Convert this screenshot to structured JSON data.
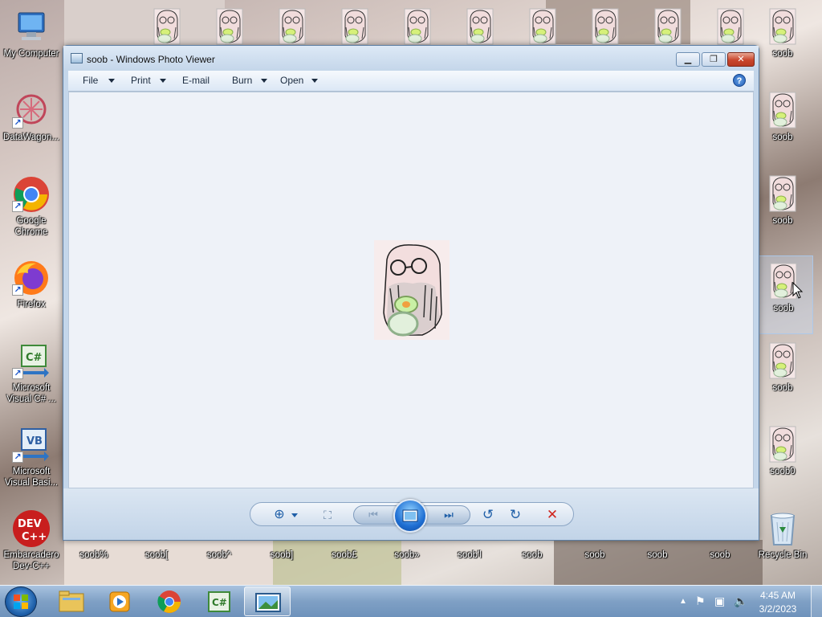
{
  "desktop": {
    "left_icons": [
      {
        "label": "My Computer",
        "icon": "computer-icon"
      },
      {
        "label": "DataWagon...",
        "icon": "datawagon-icon"
      },
      {
        "label": "Google Chrome",
        "icon": "chrome-icon"
      },
      {
        "label": "Firefox",
        "icon": "firefox-icon"
      },
      {
        "label": "Microsoft Visual C# ...",
        "icon": "visual-csharp-icon"
      },
      {
        "label": "Microsoft Visual Basi...",
        "icon": "visual-basic-icon"
      },
      {
        "label": "Embarcadero Dev-C++",
        "icon": "devcpp-icon"
      }
    ],
    "right_icons": [
      {
        "label": "soob",
        "icon": "soob-image-icon"
      },
      {
        "label": "soob",
        "icon": "soob-image-icon"
      },
      {
        "label": "soob",
        "icon": "soob-image-icon"
      },
      {
        "label": "soob",
        "icon": "soob-image-icon"
      },
      {
        "label": "soob",
        "icon": "soob-image-icon"
      },
      {
        "label": "soob0",
        "icon": "soob-image-icon"
      },
      {
        "label": "Recycle Bin",
        "icon": "recycle-bin-icon"
      }
    ],
    "bottom_icons": [
      "soob%",
      "soob[",
      "soob^",
      "soob]",
      "soob£",
      "soob»",
      "soob'l",
      "soob",
      "soob",
      "soob",
      "soob"
    ],
    "top_row_count": 11
  },
  "window": {
    "title": "soob - Windows Photo Viewer",
    "buttons": {
      "minimize": "minimize",
      "maximize": "maximize",
      "close": "close"
    },
    "menu": [
      {
        "label": "File",
        "dropdown": true
      },
      {
        "label": "Print",
        "dropdown": true
      },
      {
        "label": "E-mail",
        "dropdown": false
      },
      {
        "label": "Burn",
        "dropdown": true
      },
      {
        "label": "Open",
        "dropdown": true
      }
    ],
    "help_label": "?",
    "controls": [
      "zoom-icon",
      "actual-size-icon",
      "previous-icon",
      "slideshow-icon",
      "next-icon",
      "rotate-ccw-icon",
      "rotate-cw-icon",
      "delete-icon"
    ]
  },
  "taskbar": {
    "apps": [
      "explorer-icon",
      "media-player-icon",
      "chrome-icon",
      "visual-csharp-icon",
      "photo-viewer-icon"
    ],
    "clock_time": "4:45 AM",
    "clock_date": "3/2/2023"
  },
  "colors": {
    "accent": "#1f6fd3",
    "close_red": "#c9462d",
    "delete_red": "#d0271f"
  }
}
